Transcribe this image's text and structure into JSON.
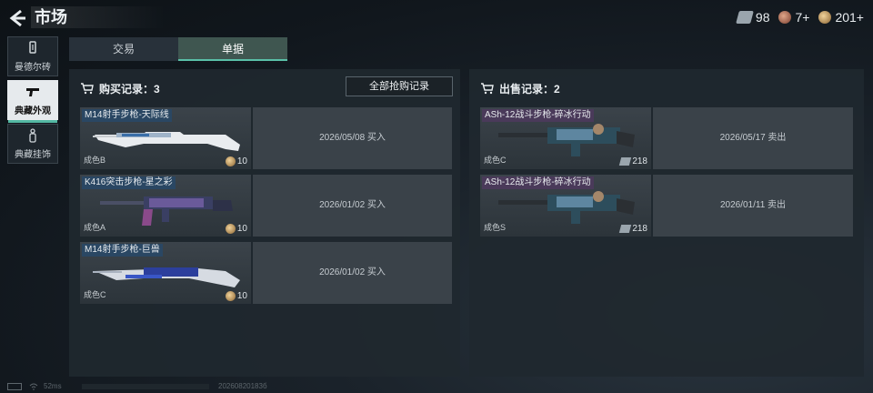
{
  "header": {
    "title": "市场",
    "currencies": [
      {
        "icon": "ticket-icon",
        "value": "98"
      },
      {
        "icon": "red-coin-icon",
        "value": "7+"
      },
      {
        "icon": "gold-coin-icon",
        "value": "201+"
      }
    ]
  },
  "sidebar": {
    "items": [
      {
        "icon": "brick-icon",
        "label": "曼德尔砖"
      },
      {
        "icon": "pistol-icon",
        "label": "典藏外观"
      },
      {
        "icon": "charm-icon",
        "label": "典藏挂饰"
      }
    ]
  },
  "tabs": [
    {
      "label": "交易"
    },
    {
      "label": "单据"
    }
  ],
  "buy": {
    "title": "购买记录：3",
    "all_button": "全部抢购记录",
    "records": [
      {
        "name": "M14射手步枪-天际线",
        "grade": "成色B",
        "price": "10",
        "info": "2026/05/08 买入"
      },
      {
        "name": "K416突击步枪-星之彩",
        "grade": "成色A",
        "price": "10",
        "info": "2026/01/02 买入"
      },
      {
        "name": "M14射手步枪-巨兽",
        "grade": "成色C",
        "price": "10",
        "info": "2026/01/02 买入"
      }
    ]
  },
  "sell": {
    "title": "出售记录：2",
    "records": [
      {
        "name": "ASh-12战斗步枪-碎冰行动",
        "grade": "成色C",
        "price": "218",
        "info": "2026/05/17 卖出"
      },
      {
        "name": "ASh-12战斗步枪-碎冰行动",
        "grade": "成色S",
        "price": "218",
        "info": "2026/01/11 卖出"
      }
    ]
  },
  "footer": {
    "ping": "52ms",
    "build": "20260820183б"
  },
  "colors": {
    "accent": "#5ac0a8",
    "panel": "#20282f",
    "blue_tag": "#2a4763",
    "purple_tag": "#4a3a5a"
  }
}
